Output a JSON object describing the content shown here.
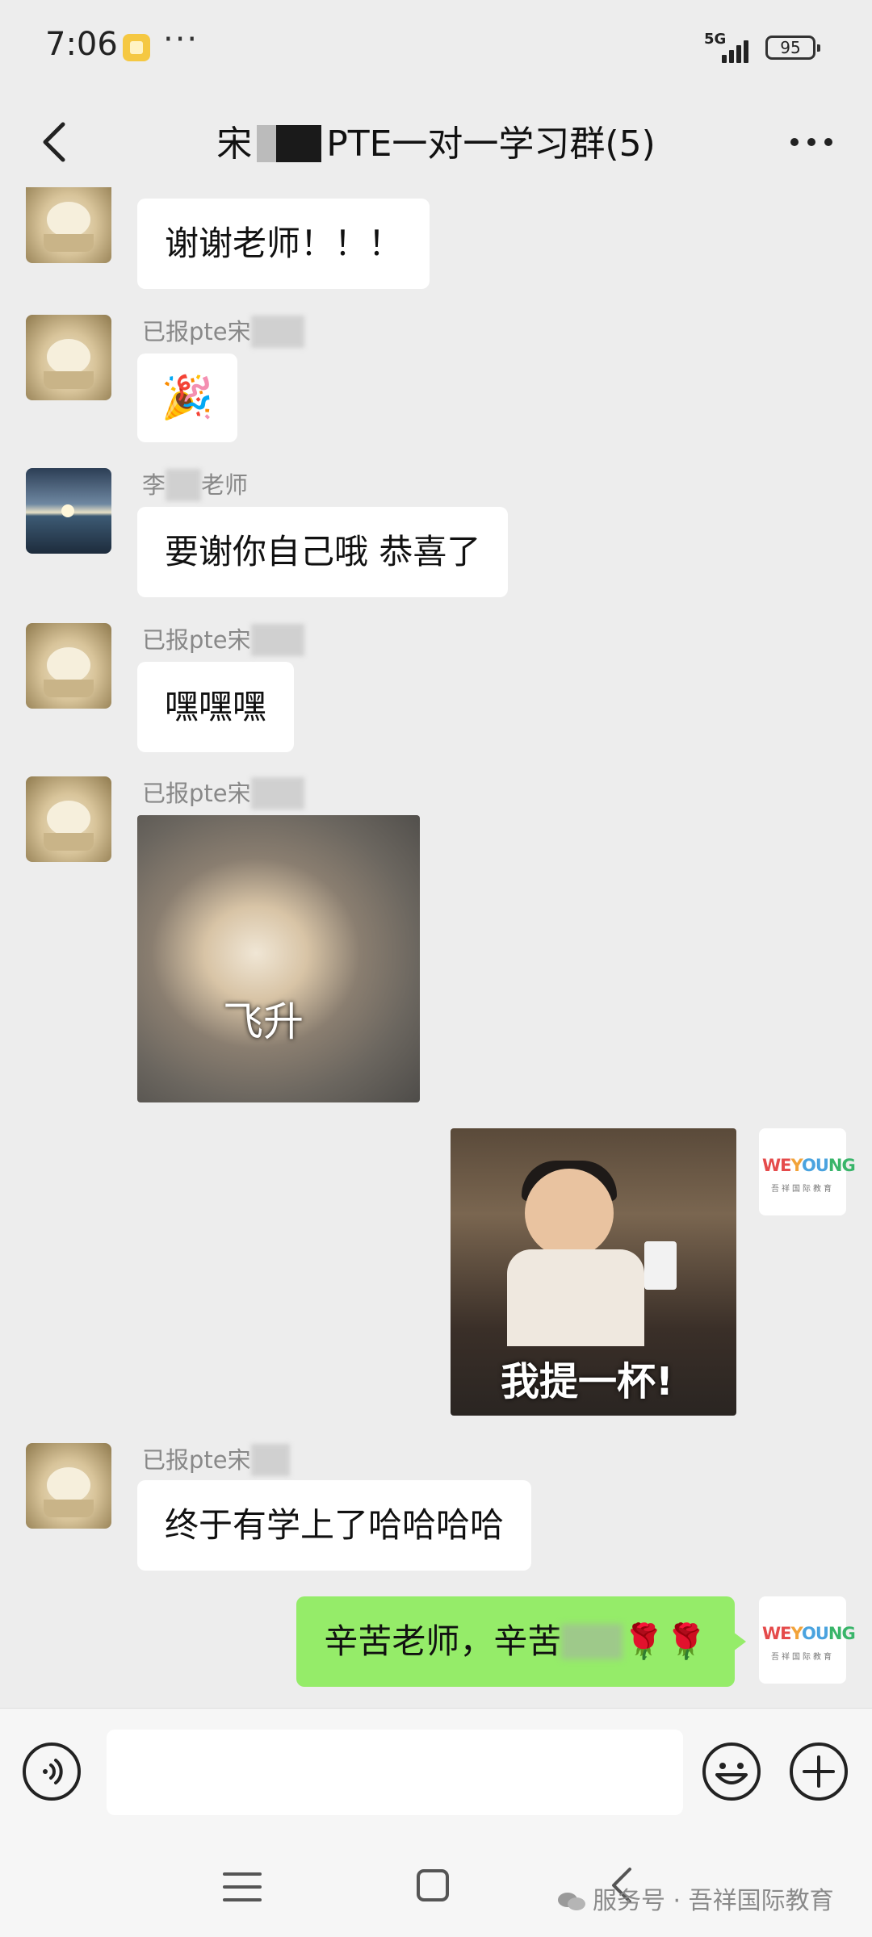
{
  "status": {
    "time": "7:06",
    "network": "5G",
    "battery": "95"
  },
  "header": {
    "title_prefix": "宋",
    "title_suffix": "PTE一对一学习群(5)"
  },
  "messages": {
    "m1": {
      "text": "谢谢老师！！！"
    },
    "m2": {
      "sender": "已报pte宋",
      "emoji": "🎉"
    },
    "m3": {
      "sender_a": "李",
      "sender_b": "老师",
      "text": "要谢你自己哦 恭喜了"
    },
    "m4": {
      "sender": "已报pte宋",
      "text": "嘿嘿嘿"
    },
    "m5": {
      "sender": "已报pte宋",
      "sticker_caption": "飞升"
    },
    "m6": {
      "sticker_caption": "我提一杯!"
    },
    "m7": {
      "sender": "已报pte宋",
      "text": "终于有学上了哈哈哈哈"
    },
    "m8": {
      "text": "辛苦老师，辛苦",
      "roses": "🌹🌹"
    }
  },
  "brand_avatar": {
    "logo_parts": [
      "WE",
      "Y",
      "OU",
      "NG"
    ],
    "subtitle": "吾祥国际教育"
  },
  "input": {
    "placeholder": ""
  },
  "watermark": {
    "text": "服务号 · 吾祥国际教育"
  },
  "colors": {
    "bubble_out": "#95ec69",
    "bubble_in": "#ffffff",
    "background": "#ededed"
  },
  "icons": [
    "back-icon",
    "more-icon",
    "voice-icon",
    "emoji-icon",
    "plus-icon",
    "menu-icon",
    "home-icon",
    "nav-back-icon",
    "wechat-icon"
  ]
}
